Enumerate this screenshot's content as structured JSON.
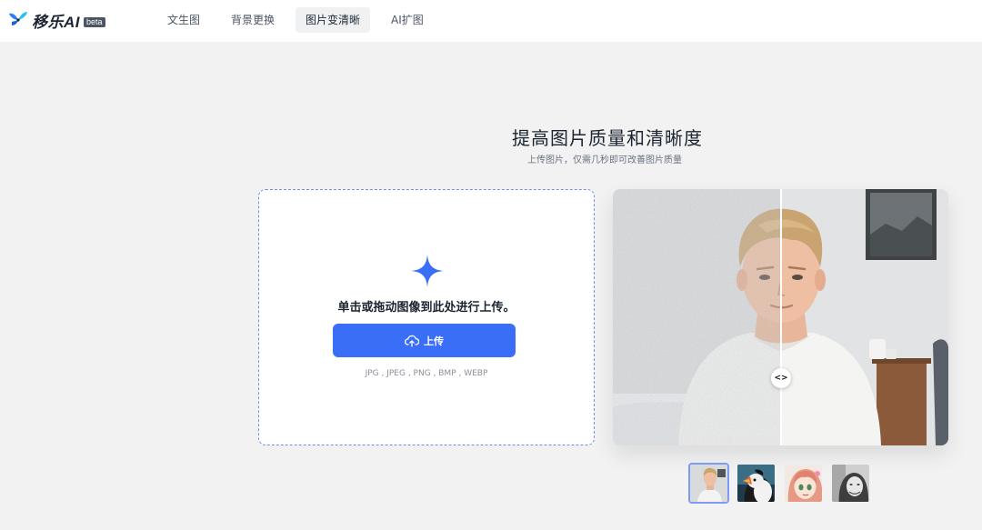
{
  "brand": {
    "name": "移乐AI",
    "badge": "beta"
  },
  "nav": {
    "items": [
      {
        "label": "文生图"
      },
      {
        "label": "背景更换"
      },
      {
        "label": "图片变清晰"
      },
      {
        "label": "AI扩图"
      }
    ],
    "active_index": 2
  },
  "hero": {
    "title": "提高图片质量和清晰度",
    "subtitle": "上传图片，仅需几秒即可改善图片质量"
  },
  "upload": {
    "hint": "单击或拖动图像到此处进行上传。",
    "button_label": "上传",
    "formats": "JPG , JPEG , PNG , BMP , WEBP",
    "icons": {
      "main": "sparkle-icon",
      "button": "cloud-upload-icon"
    }
  },
  "compare": {
    "handle_glyph": "<>"
  },
  "samples": [
    {
      "name": "young-man-portrait"
    },
    {
      "name": "puffin-bird"
    },
    {
      "name": "anime-girl"
    },
    {
      "name": "woman-bw-portrait"
    }
  ],
  "colors": {
    "accent": "#3b6ef7",
    "page_bg": "#f2f2f3",
    "dashed_border": "#6d8ff0"
  }
}
